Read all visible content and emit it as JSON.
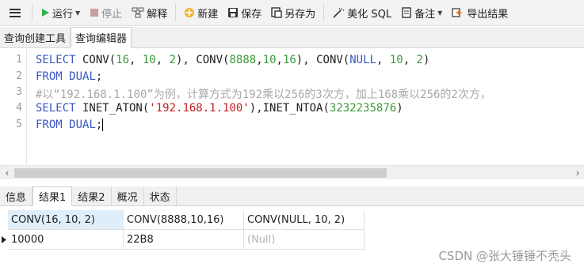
{
  "toolbar": {
    "run_label": "运行",
    "stop_label": "停止",
    "explain_label": "解释",
    "new_label": "新建",
    "save_label": "保存",
    "save_as_label": "另存为",
    "beautify_label": "美化 SQL",
    "note_label": "备注",
    "export_label": "导出结果"
  },
  "tabs": [
    {
      "label": "查询创建工具",
      "active": false
    },
    {
      "label": "查询编辑器",
      "active": true
    }
  ],
  "editor": {
    "line_numbers": [
      "1",
      "2",
      "3",
      "4",
      "5"
    ],
    "lines": {
      "l1": {
        "kw1": "SELECT",
        "f1": " CONV(",
        "n1": "16",
        "c1": ", ",
        "n2": "10",
        "c2": ", ",
        "n3": "2",
        "e1": "), ",
        "f2": "CONV(",
        "n4": "8888",
        "c3": ",",
        "n5": "10",
        "c4": ",",
        "n6": "16",
        "e2": "), ",
        "f3": "CONV(",
        "kw2": "NULL",
        "c5": ", ",
        "n7": "10",
        "c6": ", ",
        "n8": "2",
        "e3": ")"
      },
      "l2": {
        "kw1": "FROM",
        "sp": " ",
        "kw2": "DUAL",
        "e": ";"
      },
      "l3": {
        "comment": "#以“192.168.1.100”为例，计算方式为192乘以256的3次方，加上168乘以256的2次方，"
      },
      "l4": {
        "kw1": "SELECT",
        "f1": " INET_ATON(",
        "s1": "'192.168.1.100'",
        "e1": "),",
        "f2": "INET_NTOA(",
        "n1": "3232235876",
        "e2": ")"
      },
      "l5": {
        "kw1": "FROM",
        "sp": " ",
        "kw2": "DUAL",
        "e": ";"
      }
    }
  },
  "result_tabs": [
    {
      "label": "信息",
      "active": false
    },
    {
      "label": "结果1",
      "active": true
    },
    {
      "label": "结果2",
      "active": false
    },
    {
      "label": "概况",
      "active": false
    },
    {
      "label": "状态",
      "active": false
    }
  ],
  "result_grid": {
    "columns": [
      "CONV(16, 10, 2)",
      "CONV(8888,10,16)",
      "CONV(NULL, 10, 2)"
    ],
    "rows": [
      [
        "10000",
        "22B8",
        "(Null)"
      ]
    ]
  },
  "watermark": "CSDN @张大锤锤不秃头",
  "colors": {
    "keyword": "#3a57c4",
    "number": "#3a9a3a",
    "string": "#c21f1f",
    "comment": "#a8a8a8",
    "run_icon": "#2bb24c",
    "stop_icon": "#c08080"
  },
  "icons": [
    "menu-icon",
    "play-icon",
    "stop-icon",
    "explain-icon",
    "new-icon",
    "save-icon",
    "save-as-icon",
    "beautify-icon",
    "note-icon",
    "export-icon",
    "row-pointer-icon",
    "scroll-left-icon",
    "scroll-right-icon"
  ]
}
